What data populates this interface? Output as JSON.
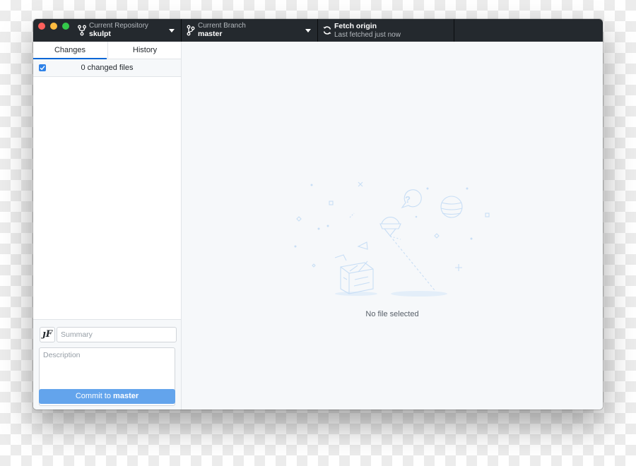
{
  "titlebar": {
    "repository": {
      "label": "Current Repository",
      "value": "skulpt",
      "icon": "repo-fork-icon"
    },
    "branch": {
      "label": "Current Branch",
      "value": "master",
      "icon": "git-branch-icon"
    },
    "fetch": {
      "title": "Fetch origin",
      "subtitle": "Last fetched just now",
      "icon": "sync-icon"
    }
  },
  "sidebar": {
    "tabs": [
      {
        "label": "Changes",
        "selected": true
      },
      {
        "label": "History",
        "selected": false
      }
    ],
    "files_summary": "0 changed files",
    "select_all_checked": true
  },
  "commit": {
    "avatar_glyph": "ȷF",
    "summary_placeholder": "Summary",
    "description_placeholder": "Description",
    "button_prefix": "Commit to ",
    "button_branch": "master"
  },
  "main": {
    "empty_label": "No file selected"
  },
  "colors": {
    "titlebar_bg": "#24292e",
    "accent": "#0366d6",
    "commit_button": "#63a4ec",
    "main_bg": "#f6f8fa"
  }
}
